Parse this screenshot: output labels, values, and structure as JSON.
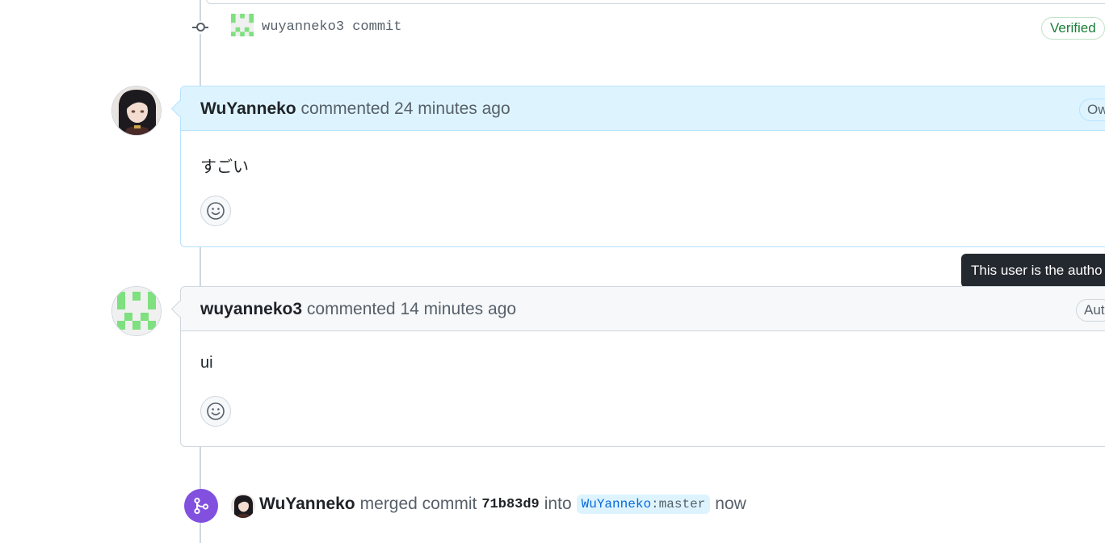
{
  "commit": {
    "author": "wuyanneko3",
    "label": "commit",
    "badge": "Verified"
  },
  "comments": [
    {
      "author": "WuYanneko",
      "action": "commented",
      "time": "24 minutes ago",
      "role_badge": "Ow",
      "body": "すごい"
    },
    {
      "author": "wuyanneko3",
      "action": "commented",
      "time": "14 minutes ago",
      "role_badge": "Aut",
      "body": "ui"
    }
  ],
  "tooltip": {
    "text": "This user is the autho"
  },
  "merge": {
    "author": "WuYanneko",
    "action": "merged commit",
    "sha": "71b83d9",
    "into": "into",
    "branch_owner": "WuYanneko",
    "branch_separator": ":",
    "branch_name": "master",
    "time": "now"
  },
  "colors": {
    "owner_header": "#ddf4ff",
    "verified_green": "#1a7f37",
    "merged_purple": "#8250df",
    "identicon_green": "#7ee07e"
  },
  "icons": {
    "commit": "git-commit-icon",
    "reaction": "smiley-icon",
    "merge": "git-merge-icon"
  }
}
